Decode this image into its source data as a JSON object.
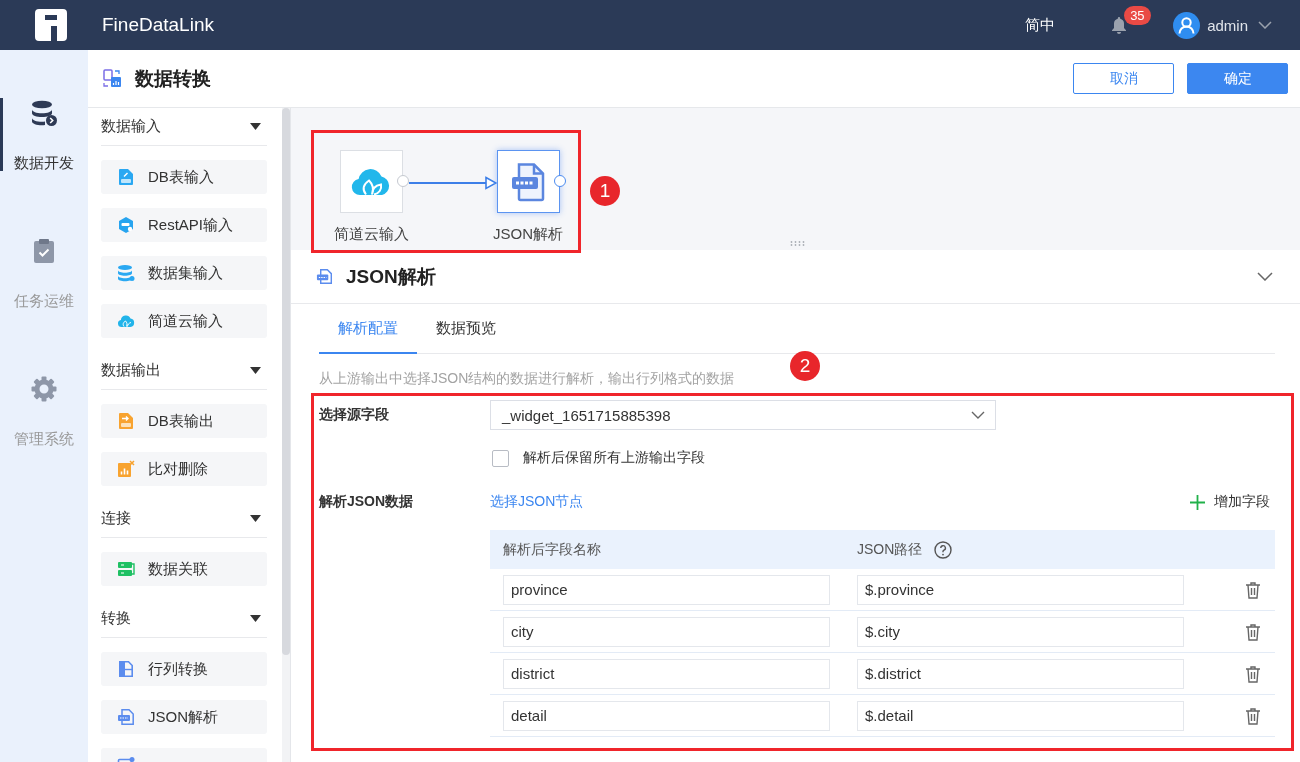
{
  "app": {
    "name": "FineDataLink",
    "language": "简中",
    "notification_count": "35",
    "user": "admin"
  },
  "nav": [
    {
      "label": "数据开发",
      "kind": "database",
      "selected": true
    },
    {
      "label": "任务运维",
      "kind": "clipboard",
      "selected": false
    },
    {
      "label": "管理系统",
      "kind": "gear",
      "selected": false
    }
  ],
  "page": {
    "title": "数据转换",
    "buttons": [
      {
        "label": "取消",
        "kind": "secondary"
      },
      {
        "label": "确定",
        "kind": "primary"
      }
    ]
  },
  "palette": [
    {
      "title": "数据输入",
      "expanded": true,
      "items": [
        {
          "label": "DB表输入",
          "kind": "db-input"
        },
        {
          "label": "RestAPI输入",
          "kind": "api"
        },
        {
          "label": "数据集输入",
          "kind": "dataset"
        },
        {
          "label": "简道云输入",
          "kind": "cloud"
        }
      ]
    },
    {
      "title": "数据输出",
      "expanded": true,
      "items": [
        {
          "label": "DB表输出",
          "kind": "db-output"
        },
        {
          "label": "比对删除",
          "kind": "compare-delete"
        }
      ]
    },
    {
      "title": "连接",
      "expanded": true,
      "items": [
        {
          "label": "数据关联",
          "kind": "join"
        }
      ]
    },
    {
      "title": "转换",
      "expanded": true,
      "items": [
        {
          "label": "行列转换",
          "kind": "row-col"
        },
        {
          "label": "JSON解析",
          "kind": "json"
        },
        {
          "kind": "field-settings"
        }
      ]
    }
  ],
  "canvas": {
    "nodes": [
      {
        "label": "简道云输入",
        "kind": "cloud",
        "selected": false
      },
      {
        "label": "JSON解析",
        "kind": "json",
        "selected": true
      }
    ]
  },
  "panel": {
    "title": "JSON解析",
    "tabs": [
      {
        "label": "解析配置",
        "selected": true
      },
      {
        "label": "数据预览",
        "selected": false
      }
    ],
    "description": "从上游输出中选择JSON结构的数据进行解析，输出行列格式的数据",
    "source_field": {
      "label": "选择源字段",
      "value": "_widget_1651715885398"
    },
    "keep_upstream": {
      "label": "解析后保留所有上游输出字段",
      "checked": false
    },
    "parse": {
      "label": "解析JSON数据",
      "link": "选择JSON节点",
      "add_button": "增加字段"
    },
    "table": {
      "columns": [
        "解析后字段名称",
        "JSON路径"
      ],
      "rows": [
        {
          "name": "province",
          "path": "$.province"
        },
        {
          "name": "city",
          "path": "$.city"
        },
        {
          "name": "district",
          "path": "$.district"
        },
        {
          "name": "detail",
          "path": "$.detail"
        }
      ]
    }
  },
  "annotations": [
    {
      "label": "1"
    },
    {
      "label": "2"
    }
  ]
}
